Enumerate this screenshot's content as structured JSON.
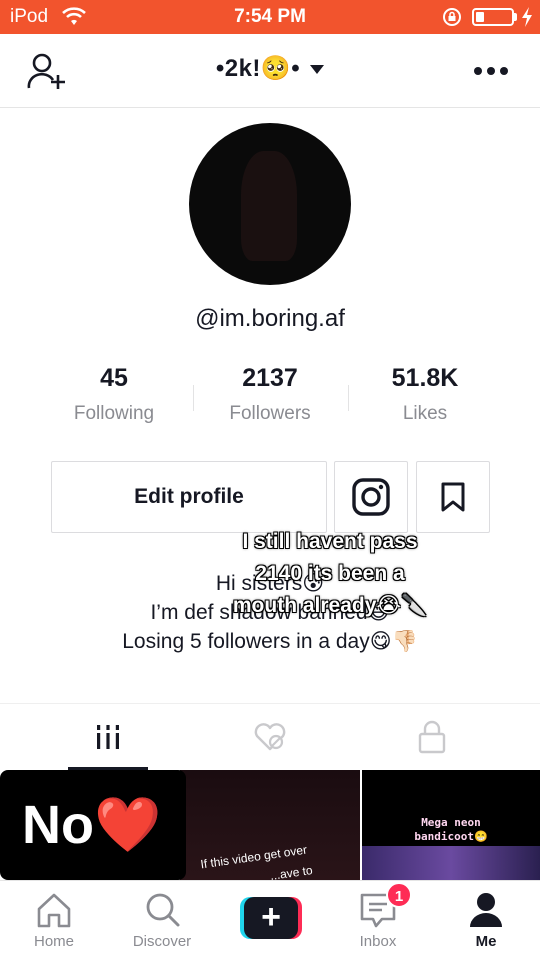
{
  "status_bar": {
    "carrier": "iPod",
    "time": "7:54 PM",
    "wifi_icon": "wifi-icon",
    "orientation_lock_icon": "rotation-lock-icon",
    "charging_icon": "bolt-icon"
  },
  "top_nav": {
    "username": "•2k!🥺•",
    "add_friend_icon": "add-user-icon",
    "more_icon": "more-dots-icon"
  },
  "profile": {
    "handle": "@im.boring.af",
    "stats": [
      {
        "value": "45",
        "label": "Following"
      },
      {
        "value": "2137",
        "label": "Followers"
      },
      {
        "value": "51.8K",
        "label": "Likes"
      }
    ],
    "edit_label": "Edit profile",
    "instagram_icon": "instagram-icon",
    "bookmark_icon": "bookmark-icon",
    "bio_lines": [
      "Hi sisters😰",
      "I’m def shadow banned😅",
      "Losing 5 followers in a day😋👎🏻"
    ]
  },
  "overlay_caption": {
    "lines": [
      "I still havent pass",
      "2140 its been a",
      "mouth already😭🔪"
    ]
  },
  "tabs": [
    {
      "name": "videos",
      "icon": "grid-icon",
      "active": true
    },
    {
      "name": "liked",
      "icon": "hidden-heart-icon",
      "active": false
    },
    {
      "name": "private",
      "icon": "lock-icon",
      "active": false
    }
  ],
  "videos": [
    {
      "text": "No❤️"
    },
    {
      "text_line1": "If this video get over",
      "text_line2": "...ave to"
    },
    {
      "text_line1": "Mega neon",
      "text_line2": "bandicoot😁"
    }
  ],
  "bottom_nav": [
    {
      "label": "Home",
      "icon": "home-icon"
    },
    {
      "label": "Discover",
      "icon": "search-icon"
    },
    {
      "label": "",
      "icon": "plus-icon"
    },
    {
      "label": "Inbox",
      "icon": "inbox-icon",
      "badge": "1"
    },
    {
      "label": "Me",
      "icon": "person-icon",
      "active": true
    }
  ],
  "colors": {
    "status_bar": "#f2542d",
    "text": "#161823",
    "muted": "#8a8b91",
    "accent_red": "#fe2c55",
    "accent_cyan": "#20d5ec"
  }
}
